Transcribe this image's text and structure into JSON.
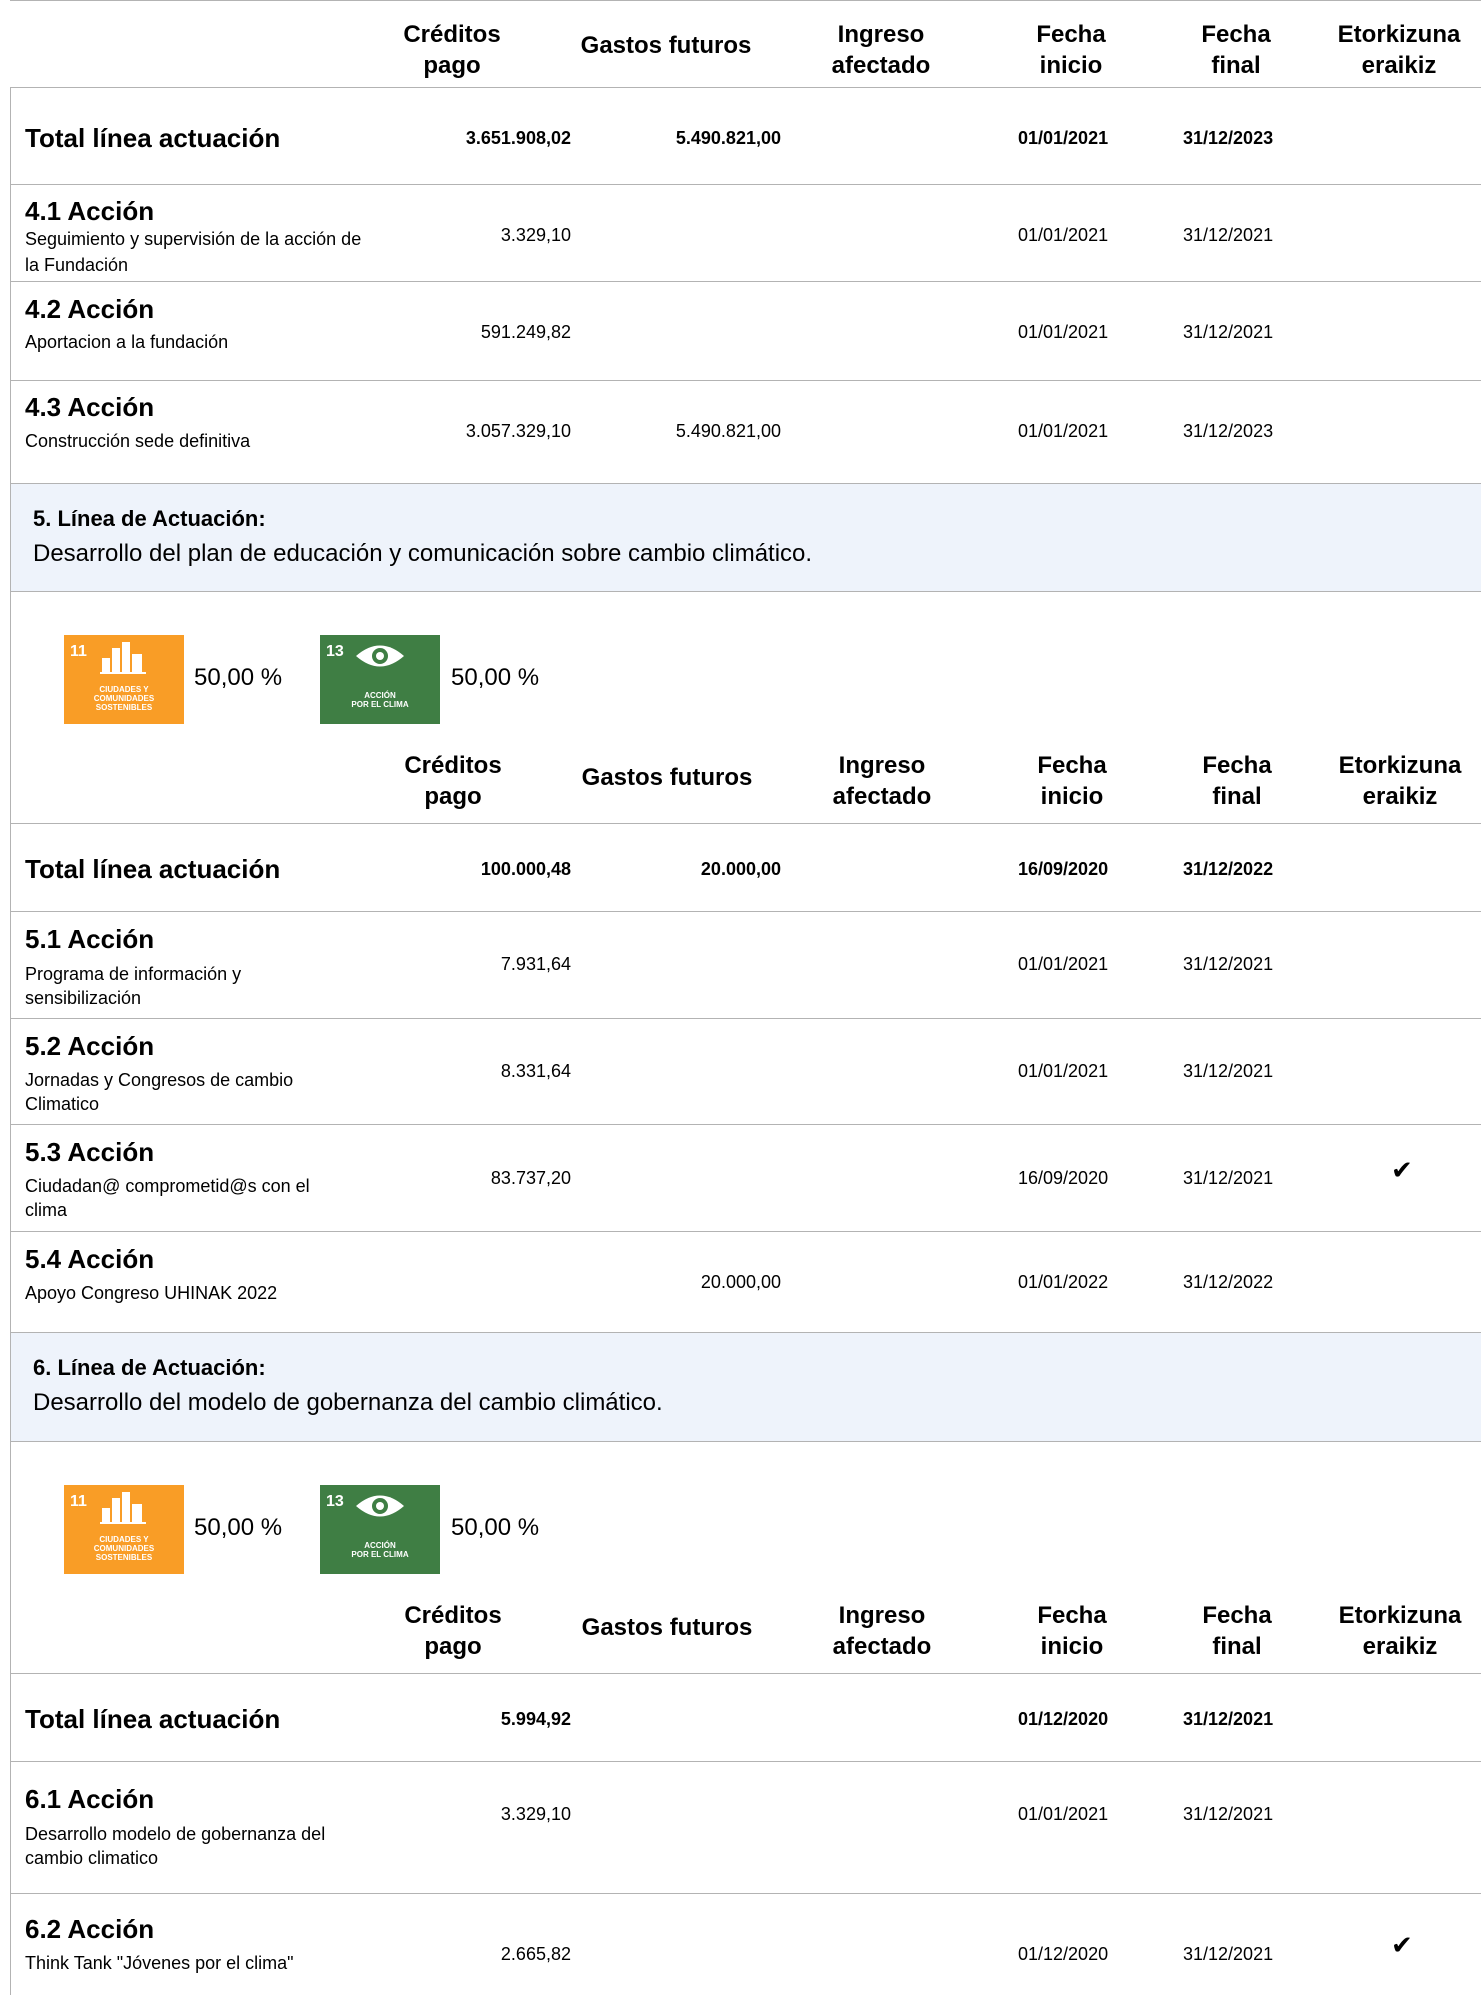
{
  "headers": {
    "creditos": [
      "Créditos",
      "pago"
    ],
    "gastos": "Gastos futuros",
    "ingreso": [
      "Ingreso",
      "afectado"
    ],
    "inicio": [
      "Fecha",
      "inicio"
    ],
    "final": [
      "Fecha",
      "final"
    ],
    "etork": [
      "Etorkizuna",
      "eraikiz"
    ]
  },
  "total_label": "Total línea actuación",
  "check_glyph": "✔",
  "sections": [
    {
      "total": {
        "creditos": "3.651.908,02",
        "gastos": "5.490.821,00",
        "inicio": "01/01/2021",
        "final": "31/12/2023"
      },
      "actions": [
        {
          "title": "4.1 Acción",
          "desc": "Seguimiento y supervisión de la acción de la Fundación",
          "creditos": "3.329,10",
          "gastos": "",
          "inicio": "01/01/2021",
          "final": "31/12/2021",
          "etork": false
        },
        {
          "title": "4.2 Acción",
          "desc": "Aportacion a la fundación",
          "creditos": "591.249,82",
          "gastos": "",
          "inicio": "01/01/2021",
          "final": "31/12/2021",
          "etork": false
        },
        {
          "title": "4.3 Acción",
          "desc": "Construcción sede definitiva",
          "creditos": "3.057.329,10",
          "gastos": "5.490.821,00",
          "inicio": "01/01/2021",
          "final": "31/12/2023",
          "etork": false
        }
      ]
    },
    {
      "line_title": "5. Línea de Actuación:",
      "line_desc": "Desarrollo del plan de educación y comunicación sobre cambio climático.",
      "ods": [
        {
          "num": "11",
          "text": [
            "CIUDADES Y",
            "COMUNIDADES",
            "SOSTENIBLES"
          ],
          "color": "#f99d26",
          "icon": "city-buildings-icon",
          "pct": "50,00 %"
        },
        {
          "num": "13",
          "text": [
            "ACCIÓN",
            "POR EL CLIMA"
          ],
          "color": "#3f7e44",
          "icon": "eye-globe-icon",
          "pct": "50,00 %"
        }
      ],
      "total": {
        "creditos": "100.000,48",
        "gastos": "20.000,00",
        "inicio": "16/09/2020",
        "final": "31/12/2022"
      },
      "actions": [
        {
          "title": "5.1 Acción",
          "desc": "Programa de información y sensibilización",
          "creditos": "7.931,64",
          "gastos": "",
          "inicio": "01/01/2021",
          "final": "31/12/2021",
          "etork": false
        },
        {
          "title": "5.2 Acción",
          "desc": "Jornadas y Congresos de cambio Climatico",
          "creditos": "8.331,64",
          "gastos": "",
          "inicio": "01/01/2021",
          "final": "31/12/2021",
          "etork": false
        },
        {
          "title": "5.3 Acción",
          "desc": "Ciudadan@ comprometid@s con el clima",
          "creditos": "83.737,20",
          "gastos": "",
          "inicio": "16/09/2020",
          "final": "31/12/2021",
          "etork": true
        },
        {
          "title": "5.4 Acción",
          "desc": "Apoyo Congreso UHINAK 2022",
          "creditos": "",
          "gastos": "20.000,00",
          "inicio": "01/01/2022",
          "final": "31/12/2022",
          "etork": false
        }
      ]
    },
    {
      "line_title": "6. Línea de Actuación:",
      "line_desc": "Desarrollo del modelo de gobernanza del cambio climático.",
      "ods": [
        {
          "num": "11",
          "text": [
            "CIUDADES Y",
            "COMUNIDADES",
            "SOSTENIBLES"
          ],
          "color": "#f99d26",
          "icon": "city-buildings-icon",
          "pct": "50,00 %"
        },
        {
          "num": "13",
          "text": [
            "ACCIÓN",
            "POR EL CLIMA"
          ],
          "color": "#3f7e44",
          "icon": "eye-globe-icon",
          "pct": "50,00 %"
        }
      ],
      "total": {
        "creditos": "5.994,92",
        "gastos": "",
        "inicio": "01/12/2020",
        "final": "31/12/2021"
      },
      "actions": [
        {
          "title": "6.1 Acción",
          "desc": "Desarrollo modelo de gobernanza del cambio climatico",
          "creditos": "3.329,10",
          "gastos": "",
          "inicio": "01/01/2021",
          "final": "31/12/2021",
          "etork": false
        },
        {
          "title": "6.2 Acción",
          "desc": "Think Tank \"Jóvenes por el clima\"",
          "creditos": "2.665,82",
          "gastos": "",
          "inicio": "01/12/2020",
          "final": "31/12/2021",
          "etork": true
        }
      ]
    }
  ]
}
